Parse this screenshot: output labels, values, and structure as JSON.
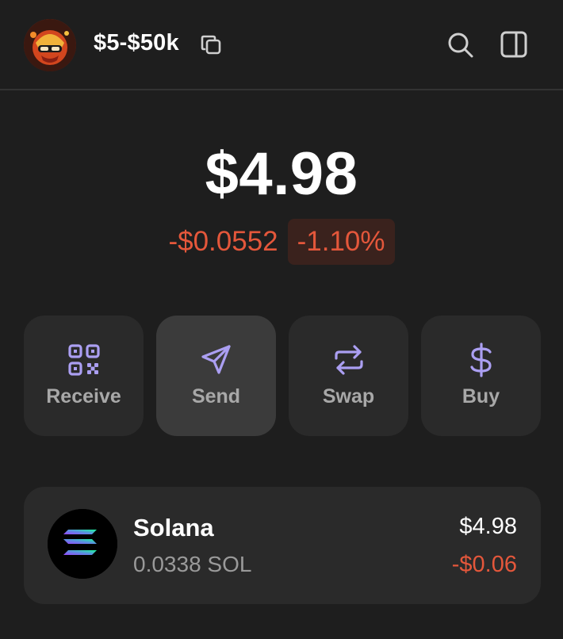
{
  "header": {
    "account_name": "$5-$50k",
    "avatar_icon": "avatar-image",
    "copy_icon": "copy-icon",
    "search_icon": "search-icon",
    "panel_icon": "sidebar-panel-icon"
  },
  "balance": {
    "total": "$4.98",
    "change_amount": "-$0.0552",
    "change_percent": "-1.10%"
  },
  "actions": [
    {
      "label": "Receive",
      "icon": "qr-code-icon"
    },
    {
      "label": "Send",
      "icon": "send-icon"
    },
    {
      "label": "Swap",
      "icon": "swap-icon"
    },
    {
      "label": "Buy",
      "icon": "dollar-icon"
    }
  ],
  "tokens": [
    {
      "name": "Solana",
      "amount": "0.0338 SOL",
      "value": "$4.98",
      "change": "-$0.06",
      "icon": "solana-logo"
    }
  ],
  "colors": {
    "background": "#1e1e1e",
    "card": "#2a2a2a",
    "accent": "#ab9ff2",
    "negative": "#e4573b"
  }
}
